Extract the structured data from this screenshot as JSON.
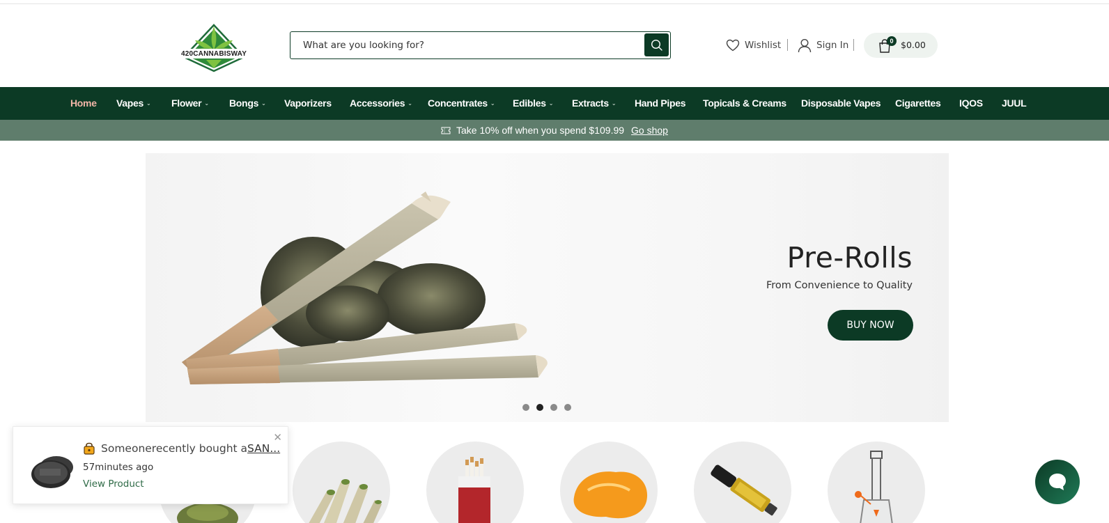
{
  "brand": {
    "logo_text": "420CANNABISWAY",
    "accent": "#0c3a25"
  },
  "search": {
    "placeholder": "What are you looking for?"
  },
  "header": {
    "wishlist_label": "Wishlist",
    "signin_label": "Sign In",
    "cart_count": "0",
    "cart_total": "$0.00"
  },
  "nav": {
    "items": [
      {
        "label": "Home",
        "dropdown": false,
        "active": true
      },
      {
        "label": "Vapes",
        "dropdown": true
      },
      {
        "label": "Flower",
        "dropdown": true
      },
      {
        "label": "Bongs",
        "dropdown": true
      },
      {
        "label": "Vaporizers",
        "dropdown": false
      },
      {
        "label": "Accessories",
        "dropdown": true
      },
      {
        "label": "Concentrates",
        "dropdown": true
      },
      {
        "label": "Edibles",
        "dropdown": true
      },
      {
        "label": "Extracts",
        "dropdown": true
      },
      {
        "label": "Hand Pipes",
        "dropdown": false
      },
      {
        "label": "Topicals & Creams",
        "dropdown": false
      },
      {
        "label": "Disposable Vapes",
        "dropdown": false
      },
      {
        "label": "Cigarettes",
        "dropdown": false
      },
      {
        "label": "IQOS",
        "dropdown": false
      },
      {
        "label": "JUUL",
        "dropdown": false
      }
    ]
  },
  "promo": {
    "text": "Take 10% off when you spend $109.99",
    "link": "Go shop"
  },
  "hero": {
    "title": "Pre-Rolls",
    "subtitle": "From Convenience to Quality",
    "button": "BUY NOW",
    "slide_count": 4,
    "active_slide": 2
  },
  "toast": {
    "prefix": "Someonerecently bought a",
    "product": "SAN...",
    "time": "57minutes ago",
    "view_label": "View Product"
  }
}
